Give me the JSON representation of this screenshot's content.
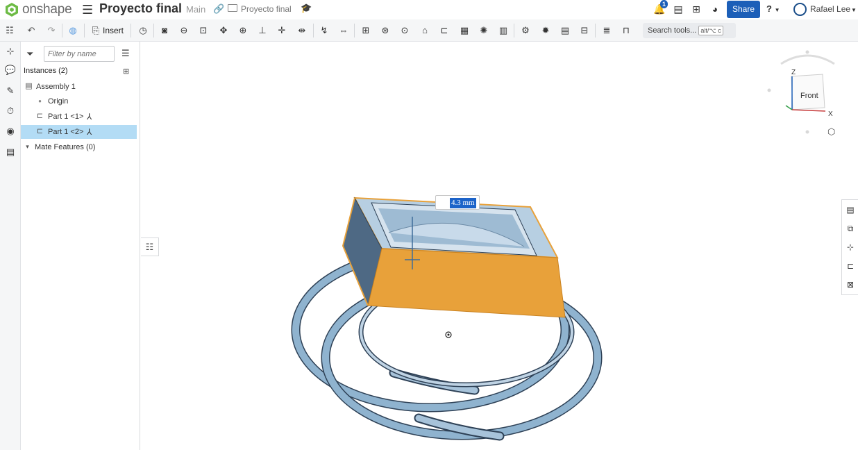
{
  "app": {
    "brand": "onshape",
    "document_title": "Proyecto final",
    "branch": "Main",
    "folder": "Proyecto final",
    "notification_count": "1",
    "share_label": "Share",
    "help_label": "?",
    "user_name": "Rafael Lee"
  },
  "toolbar": {
    "insert_label": "Insert",
    "search_placeholder": "Search tools...",
    "search_shortcut": "alt/⌥ c"
  },
  "panel": {
    "filter_placeholder": "Filter by name",
    "instances_title": "Instances (2)",
    "tree": [
      {
        "label": "Assembly 1",
        "indent": 1,
        "selected": false
      },
      {
        "label": "Origin",
        "indent": 2,
        "selected": false
      },
      {
        "label": "Part 1 <1>",
        "indent": 2,
        "selected": false
      },
      {
        "label": "Part 1 <2>",
        "indent": 2,
        "selected": true
      },
      {
        "label": "Mate Features (0)",
        "indent": 0,
        "selected": false
      }
    ]
  },
  "viewport": {
    "dimension_value": "4.3 mm",
    "view_cube_face": "Front",
    "axis_z": "Z",
    "axis_x": "X"
  },
  "colors": {
    "accent": "#1c5fb8",
    "selection_orange": "#e8a13a",
    "part_blue": "#8fb3cf",
    "tree_selected": "#b3dcf5"
  }
}
